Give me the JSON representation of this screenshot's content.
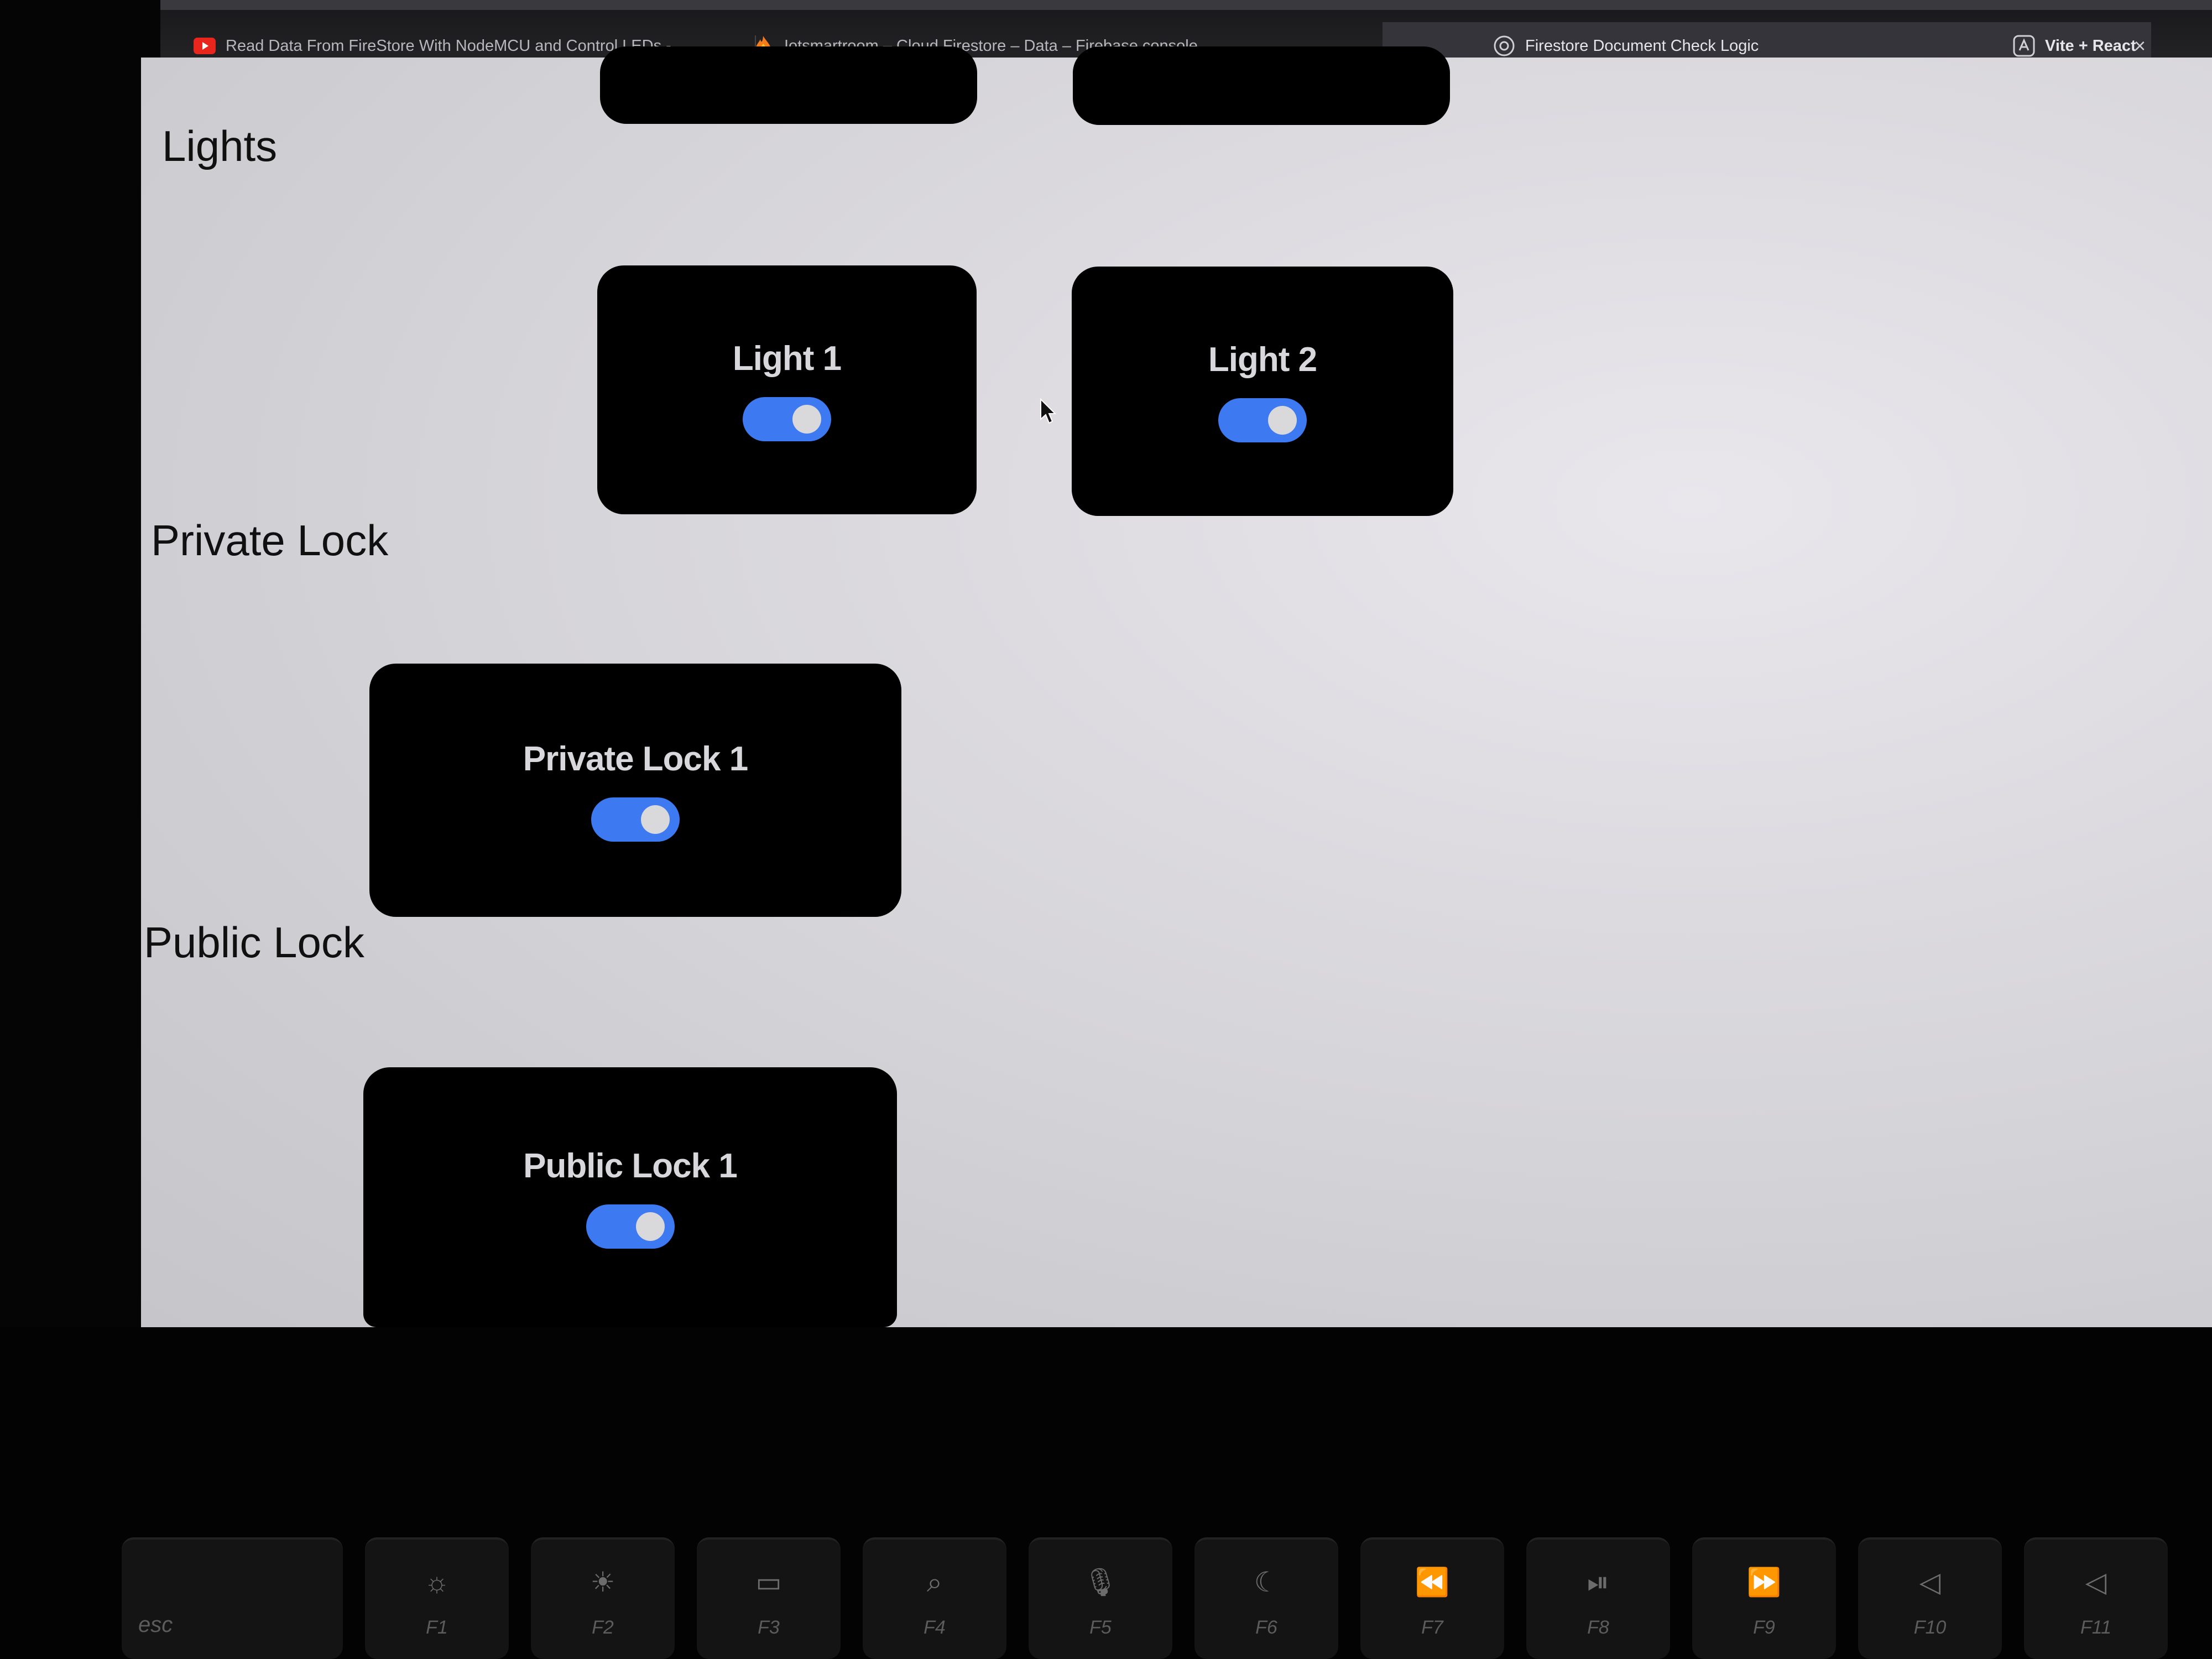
{
  "browser": {
    "tabs": [
      {
        "title": "Read Data From FireStore With NodeMCU and Control LEDs -...",
        "icon": "youtube-icon",
        "active": false
      },
      {
        "title": "Iotsmartroom – Cloud Firestore – Data – Firebase console",
        "icon": "firebase-icon",
        "active": false
      },
      {
        "title": "Firestore Document Check Logic",
        "icon": "chatgpt-icon",
        "active": true
      },
      {
        "title": "Vite + React",
        "icon": "vite-icon",
        "active": false
      }
    ],
    "close_glyph": "×"
  },
  "sections": {
    "lights": {
      "title": "Lights",
      "devices": [
        {
          "label": "Light 1",
          "on": true
        },
        {
          "label": "Light 2",
          "on": true
        }
      ]
    },
    "private_lock": {
      "title": "Private Lock",
      "devices": [
        {
          "label": "Private Lock 1",
          "on": true
        }
      ]
    },
    "public_lock": {
      "title": "Public Lock",
      "devices": [
        {
          "label": "Public Lock 1",
          "on": true
        }
      ]
    }
  },
  "colors": {
    "toggle_on": "#3d7af2",
    "card_bg": "#000000",
    "page_bg": "#d9d8dd"
  },
  "keyboard": {
    "keys": [
      {
        "fn": "esc",
        "icon": "none"
      },
      {
        "fn": "F1",
        "icon": "brightness-down-icon",
        "glyph": "☼"
      },
      {
        "fn": "F2",
        "icon": "brightness-up-icon",
        "glyph": "☀"
      },
      {
        "fn": "F3",
        "icon": "mission-control-icon",
        "glyph": "▭"
      },
      {
        "fn": "F4",
        "icon": "spotlight-search-icon",
        "glyph": "⌕"
      },
      {
        "fn": "F5",
        "icon": "dictation-mic-icon",
        "glyph": "🎙"
      },
      {
        "fn": "F6",
        "icon": "do-not-disturb-moon-icon",
        "glyph": "☾"
      },
      {
        "fn": "F7",
        "icon": "rewind-icon",
        "glyph": "⏪"
      },
      {
        "fn": "F8",
        "icon": "play-pause-icon",
        "glyph": "⏯"
      },
      {
        "fn": "F9",
        "icon": "fast-forward-icon",
        "glyph": "⏩"
      },
      {
        "fn": "F10",
        "icon": "mute-icon",
        "glyph": "◁"
      },
      {
        "fn": "F11",
        "icon": "volume-down-icon",
        "glyph": "◁"
      }
    ]
  }
}
